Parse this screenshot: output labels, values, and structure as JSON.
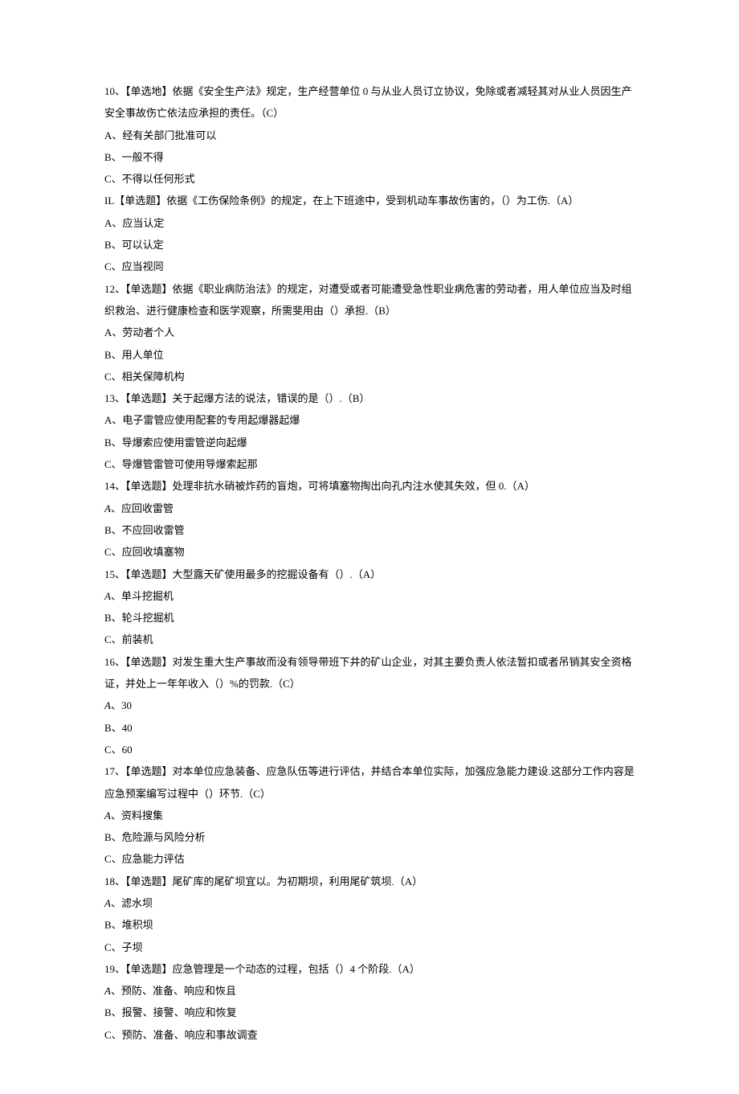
{
  "questions": [
    {
      "id": "q10",
      "text": "10、【单选地】依据《安全生产法》规定，生产经营单位 0 与从业人员订立协议，免除或者减轻其对从业人员因生产安全事故伤亡依法应承担的责任。（C）",
      "options": [
        "A、经有关部门批准可以",
        "B、一般不得",
        "C、不得以任何形式"
      ]
    },
    {
      "id": "q11",
      "text": "IL【单选题】依据《工伤保险条例》的规定，在上下班途中，受到机动车事故伤害的，（）为工伤.（A）",
      "options": [
        "A、应当认定",
        "B、可以认定",
        "C、应当视同"
      ]
    },
    {
      "id": "q12",
      "text": "12、【单选题】依据《职业病防治法》的规定，对遭受或者可能遭受急性职业病危害的劳动者，用人单位应当及时组织救治、进行健康检查和医学观察，所需斐用由（）承担.（B）",
      "options": [
        "A、劳动者个人",
        "B、用人单位",
        "C、相关保障机构"
      ]
    },
    {
      "id": "q13",
      "text": "13、【单选题】关于起爆方法的说法，错误的是（）.（B）",
      "options": [
        "A、电子雷管应使用配套的专用起爆器起爆",
        "B、导爆索应使用雷管逆向起爆",
        "C、导爆管雷管可使用导爆索起那"
      ]
    },
    {
      "id": "q14",
      "text": "14、【单选题】处理非抗水硝被炸药的盲炮，可将填塞物掏出向孔内注水使其失效，但 0.（A）",
      "italicFirst": true,
      "options": [
        "A、应回收雷管",
        "B、不应回收雷管",
        "C、应回收填塞物"
      ]
    },
    {
      "id": "q15",
      "text": "15、【单选题】大型露天矿使用最多的挖掘设备有（）.（A）",
      "italicFirst": true,
      "options": [
        "A、单斗挖掘机",
        "B、轮斗挖掘机",
        "C、前装机"
      ]
    },
    {
      "id": "q16",
      "text": "16、【单选题】对发生重大生产事故而没有领导带班下井的矿山企业，对其主要负责人依法暂扣或者吊销其安全资格证，并处上一年年收入（）%的罚款.（C）",
      "italicFirst": true,
      "options": [
        "A、30",
        "B、40",
        "C、60"
      ]
    },
    {
      "id": "q17",
      "text": "17、【单选题】对本单位应急装备、应急队伍等进行评估，并结合本单位实际，加强应急能力建设.这部分工作内容是应急预案编写过程中（）环节.（C）",
      "italicFirst": true,
      "options": [
        "A、资料搜集",
        "B、危险源与风险分析",
        "C、应急能力评估"
      ]
    },
    {
      "id": "q18",
      "text": "18、【单选题】尾矿库的尾矿坝宜以。为初期坝，利用尾矿筑坝.（A）",
      "italicFirst": true,
      "options": [
        "A、滤水坝",
        "B、堆积坝",
        "C、子坝"
      ]
    },
    {
      "id": "q19",
      "text": "19、【单选题】应急管理是一个动态的过程，包括（）4 个阶段.（A）",
      "italicFirst": true,
      "options": [
        "A、预防、准备、响应和恢且",
        "B、报警、接警、响应和恢复",
        "C、预防、准备、响应和事故调查"
      ]
    }
  ]
}
